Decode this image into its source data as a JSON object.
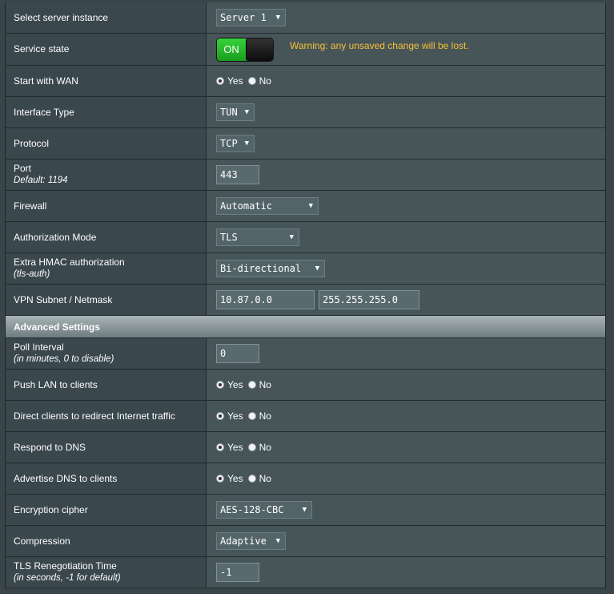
{
  "rows": {
    "server_instance": {
      "label": "Select server instance",
      "value": "Server 1"
    },
    "service_state": {
      "label": "Service state",
      "toggle": "ON",
      "warning": "Warning: any unsaved change will be lost."
    },
    "start_wan": {
      "label": "Start with WAN",
      "yes": "Yes",
      "no": "No"
    },
    "interface_type": {
      "label": "Interface Type",
      "value": "TUN"
    },
    "protocol": {
      "label": "Protocol",
      "value": "TCP"
    },
    "port": {
      "label": "Port",
      "sub": "Default: 1194",
      "value": "443"
    },
    "firewall": {
      "label": "Firewall",
      "value": "Automatic"
    },
    "auth_mode": {
      "label": "Authorization Mode",
      "value": "TLS"
    },
    "hmac": {
      "label": "Extra HMAC authorization",
      "sub": "(tls-auth)",
      "value": "Bi-directional"
    },
    "subnet": {
      "label": "VPN Subnet / Netmask",
      "subnet": "10.87.0.0",
      "netmask": "255.255.255.0"
    }
  },
  "advanced": {
    "title": "Advanced Settings",
    "poll": {
      "label": "Poll Interval",
      "sub": "(in minutes, 0 to disable)",
      "value": "0"
    },
    "push_lan": {
      "label": "Push LAN to clients",
      "yes": "Yes",
      "no": "No"
    },
    "redirect": {
      "label": "Direct clients to redirect Internet traffic",
      "yes": "Yes",
      "no": "No"
    },
    "respond_dns": {
      "label": "Respond to DNS",
      "yes": "Yes",
      "no": "No"
    },
    "advertise_dns": {
      "label": "Advertise DNS to clients",
      "yes": "Yes",
      "no": "No"
    },
    "cipher": {
      "label": "Encryption cipher",
      "value": "AES-128-CBC"
    },
    "compression": {
      "label": "Compression",
      "value": "Adaptive"
    },
    "tls_reneg": {
      "label": "TLS Renegotiation Time",
      "sub": "(in seconds, -1 for default)",
      "value": "-1"
    }
  },
  "colors": {
    "warning": "#f7c035",
    "toggle_on": "#2fc233"
  }
}
